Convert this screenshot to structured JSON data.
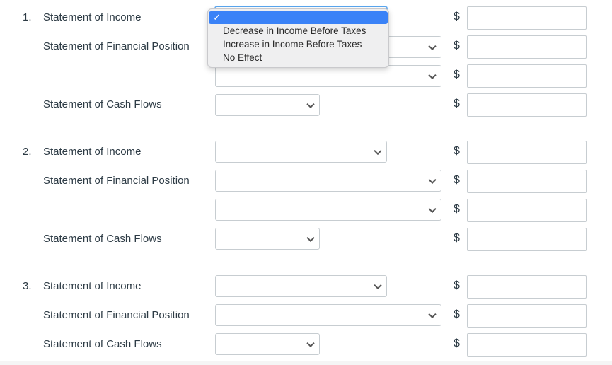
{
  "questions": [
    {
      "number": "1.",
      "rows": [
        {
          "label": "Statement of Income",
          "select_value": "",
          "amount": ""
        },
        {
          "label": "Statement of Financial Position",
          "select_value": "",
          "amount": ""
        },
        {
          "label": "",
          "select_value": "",
          "amount": ""
        },
        {
          "label": "Statement of Cash Flows",
          "select_value": "",
          "amount": ""
        }
      ]
    },
    {
      "number": "2.",
      "rows": [
        {
          "label": "Statement of Income",
          "select_value": "",
          "amount": ""
        },
        {
          "label": "Statement of Financial Position",
          "select_value": "",
          "amount": ""
        },
        {
          "label": "",
          "select_value": "",
          "amount": ""
        },
        {
          "label": "Statement of Cash Flows",
          "select_value": "",
          "amount": ""
        }
      ]
    },
    {
      "number": "3.",
      "rows": [
        {
          "label": "Statement of Income",
          "select_value": "",
          "amount": ""
        },
        {
          "label": "Statement of Financial Position",
          "select_value": "",
          "amount": ""
        },
        {
          "label": "Statement of Cash Flows",
          "select_value": "",
          "amount": ""
        }
      ]
    }
  ],
  "currency_symbol": "$",
  "dropdown": {
    "open": true,
    "checkmark": "✓",
    "options": [
      "",
      "Decrease in Income Before Taxes",
      "Increase in Income Before Taxes",
      "No Effect"
    ],
    "selected_index": 0
  },
  "colors": {
    "highlight": "#3a82f7",
    "text": "#2d3b45",
    "border": "#c7cdd1"
  }
}
